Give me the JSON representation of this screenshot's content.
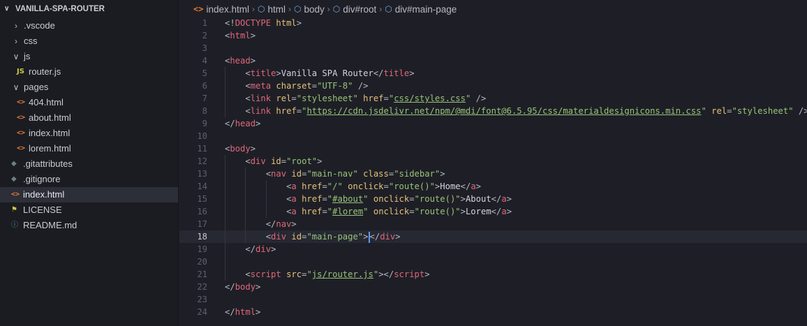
{
  "explorer": {
    "title": "VANILLA-SPA-ROUTER",
    "items": [
      {
        "label": ".vscode",
        "kind": "folder",
        "state": "collapsed",
        "depth": 1
      },
      {
        "label": "css",
        "kind": "folder",
        "state": "collapsed",
        "depth": 1
      },
      {
        "label": "js",
        "kind": "folder",
        "state": "expanded",
        "depth": 1
      },
      {
        "label": "router.js",
        "kind": "js",
        "depth": 2
      },
      {
        "label": "pages",
        "kind": "folder",
        "state": "expanded",
        "depth": 1
      },
      {
        "label": "404.html",
        "kind": "html",
        "depth": 2
      },
      {
        "label": "about.html",
        "kind": "html",
        "depth": 2
      },
      {
        "label": "index.html",
        "kind": "html",
        "depth": 2
      },
      {
        "label": "lorem.html",
        "kind": "html",
        "depth": 2
      },
      {
        "label": ".gitattributes",
        "kind": "git",
        "depth": 1
      },
      {
        "label": ".gitignore",
        "kind": "git",
        "depth": 1
      },
      {
        "label": "index.html",
        "kind": "html",
        "depth": 1,
        "selected": true
      },
      {
        "label": "LICENSE",
        "kind": "license",
        "depth": 1
      },
      {
        "label": "README.md",
        "kind": "info",
        "depth": 1
      }
    ]
  },
  "breadcrumb": [
    "index.html",
    "html",
    "body",
    "div#root",
    "div#main-page"
  ],
  "editor": {
    "current_line": 18,
    "lines": [
      [
        [
          "t-br",
          "<!"
        ],
        [
          "t-doctype",
          "DOCTYPE"
        ],
        [
          "t-text",
          " "
        ],
        [
          "t-attr",
          "html"
        ],
        [
          "t-br",
          ">"
        ]
      ],
      [
        [
          "t-br",
          "<"
        ],
        [
          "t-tag",
          "html"
        ],
        [
          "t-br",
          ">"
        ]
      ],
      [],
      [
        [
          "t-br",
          "<"
        ],
        [
          "t-tag",
          "head"
        ],
        [
          "t-br",
          ">"
        ]
      ],
      [
        [
          "t-text",
          "    "
        ],
        [
          "t-br",
          "<"
        ],
        [
          "t-tag",
          "title"
        ],
        [
          "t-br",
          ">"
        ],
        [
          "t-text",
          "Vanilla SPA Router"
        ],
        [
          "t-br",
          "</"
        ],
        [
          "t-tag",
          "title"
        ],
        [
          "t-br",
          ">"
        ]
      ],
      [
        [
          "t-text",
          "    "
        ],
        [
          "t-br",
          "<"
        ],
        [
          "t-tag",
          "meta"
        ],
        [
          "t-text",
          " "
        ],
        [
          "t-attr",
          "charset"
        ],
        [
          "t-br",
          "="
        ],
        [
          "t-str",
          "\"UTF-8\""
        ],
        [
          "t-text",
          " "
        ],
        [
          "t-br",
          "/>"
        ]
      ],
      [
        [
          "t-text",
          "    "
        ],
        [
          "t-br",
          "<"
        ],
        [
          "t-tag",
          "link"
        ],
        [
          "t-text",
          " "
        ],
        [
          "t-attr",
          "rel"
        ],
        [
          "t-br",
          "="
        ],
        [
          "t-str",
          "\"stylesheet\""
        ],
        [
          "t-text",
          " "
        ],
        [
          "t-attr",
          "href"
        ],
        [
          "t-br",
          "="
        ],
        [
          "t-str",
          "\""
        ],
        [
          "t-url",
          "css/styles.css"
        ],
        [
          "t-str",
          "\""
        ],
        [
          "t-text",
          " "
        ],
        [
          "t-br",
          "/>"
        ]
      ],
      [
        [
          "t-text",
          "    "
        ],
        [
          "t-br",
          "<"
        ],
        [
          "t-tag",
          "link"
        ],
        [
          "t-text",
          " "
        ],
        [
          "t-attr",
          "href"
        ],
        [
          "t-br",
          "="
        ],
        [
          "t-str",
          "\""
        ],
        [
          "t-url",
          "https://cdn.jsdelivr.net/npm/@mdi/font@6.5.95/css/materialdesignicons.min.css"
        ],
        [
          "t-str",
          "\""
        ],
        [
          "t-text",
          " "
        ],
        [
          "t-attr",
          "rel"
        ],
        [
          "t-br",
          "="
        ],
        [
          "t-str",
          "\"stylesheet\""
        ],
        [
          "t-text",
          " "
        ],
        [
          "t-br",
          "/>"
        ]
      ],
      [
        [
          "t-br",
          "</"
        ],
        [
          "t-tag",
          "head"
        ],
        [
          "t-br",
          ">"
        ]
      ],
      [],
      [
        [
          "t-br",
          "<"
        ],
        [
          "t-tag",
          "body"
        ],
        [
          "t-br",
          ">"
        ]
      ],
      [
        [
          "t-text",
          "    "
        ],
        [
          "t-br",
          "<"
        ],
        [
          "t-tag",
          "div"
        ],
        [
          "t-text",
          " "
        ],
        [
          "t-attr",
          "id"
        ],
        [
          "t-br",
          "="
        ],
        [
          "t-str",
          "\"root\""
        ],
        [
          "t-br",
          ">"
        ]
      ],
      [
        [
          "t-text",
          "        "
        ],
        [
          "t-br",
          "<"
        ],
        [
          "t-tag",
          "nav"
        ],
        [
          "t-text",
          " "
        ],
        [
          "t-attr",
          "id"
        ],
        [
          "t-br",
          "="
        ],
        [
          "t-str",
          "\"main-nav\""
        ],
        [
          "t-text",
          " "
        ],
        [
          "t-attr",
          "class"
        ],
        [
          "t-br",
          "="
        ],
        [
          "t-str",
          "\"sidebar\""
        ],
        [
          "t-br",
          ">"
        ]
      ],
      [
        [
          "t-text",
          "            "
        ],
        [
          "t-br",
          "<"
        ],
        [
          "t-tag",
          "a"
        ],
        [
          "t-text",
          " "
        ],
        [
          "t-attr",
          "href"
        ],
        [
          "t-br",
          "="
        ],
        [
          "t-str",
          "\"/\""
        ],
        [
          "t-text",
          " "
        ],
        [
          "t-attr",
          "onclick"
        ],
        [
          "t-br",
          "="
        ],
        [
          "t-str",
          "\"route()\""
        ],
        [
          "t-br",
          ">"
        ],
        [
          "t-text",
          "Home"
        ],
        [
          "t-br",
          "</"
        ],
        [
          "t-tag",
          "a"
        ],
        [
          "t-br",
          ">"
        ]
      ],
      [
        [
          "t-text",
          "            "
        ],
        [
          "t-br",
          "<"
        ],
        [
          "t-tag",
          "a"
        ],
        [
          "t-text",
          " "
        ],
        [
          "t-attr",
          "href"
        ],
        [
          "t-br",
          "="
        ],
        [
          "t-str",
          "\""
        ],
        [
          "t-url",
          "#about"
        ],
        [
          "t-str",
          "\""
        ],
        [
          "t-text",
          " "
        ],
        [
          "t-attr",
          "onclick"
        ],
        [
          "t-br",
          "="
        ],
        [
          "t-str",
          "\"route()\""
        ],
        [
          "t-br",
          ">"
        ],
        [
          "t-text",
          "About"
        ],
        [
          "t-br",
          "</"
        ],
        [
          "t-tag",
          "a"
        ],
        [
          "t-br",
          ">"
        ]
      ],
      [
        [
          "t-text",
          "            "
        ],
        [
          "t-br",
          "<"
        ],
        [
          "t-tag",
          "a"
        ],
        [
          "t-text",
          " "
        ],
        [
          "t-attr",
          "href"
        ],
        [
          "t-br",
          "="
        ],
        [
          "t-str",
          "\""
        ],
        [
          "t-url",
          "#lorem"
        ],
        [
          "t-str",
          "\""
        ],
        [
          "t-text",
          " "
        ],
        [
          "t-attr",
          "onclick"
        ],
        [
          "t-br",
          "="
        ],
        [
          "t-str",
          "\"route()\""
        ],
        [
          "t-br",
          ">"
        ],
        [
          "t-text",
          "Lorem"
        ],
        [
          "t-br",
          "</"
        ],
        [
          "t-tag",
          "a"
        ],
        [
          "t-br",
          ">"
        ]
      ],
      [
        [
          "t-text",
          "        "
        ],
        [
          "t-br",
          "</"
        ],
        [
          "t-tag",
          "nav"
        ],
        [
          "t-br",
          ">"
        ]
      ],
      [
        [
          "t-text",
          "        "
        ],
        [
          "t-br",
          "<"
        ],
        [
          "t-tag",
          "div"
        ],
        [
          "t-text",
          " "
        ],
        [
          "t-attr",
          "id"
        ],
        [
          "t-br",
          "="
        ],
        [
          "t-str",
          "\"main-page\""
        ],
        [
          "t-br",
          ">"
        ],
        [
          "cursor",
          ""
        ],
        [
          "t-br",
          "</"
        ],
        [
          "t-tag",
          "div"
        ],
        [
          "t-br",
          ">"
        ]
      ],
      [
        [
          "t-text",
          "    "
        ],
        [
          "t-br",
          "</"
        ],
        [
          "t-tag",
          "div"
        ],
        [
          "t-br",
          ">"
        ]
      ],
      [],
      [
        [
          "t-text",
          "    "
        ],
        [
          "t-br",
          "<"
        ],
        [
          "t-tag",
          "script"
        ],
        [
          "t-text",
          " "
        ],
        [
          "t-attr",
          "src"
        ],
        [
          "t-br",
          "="
        ],
        [
          "t-str",
          "\""
        ],
        [
          "t-url",
          "js/router.js"
        ],
        [
          "t-str",
          "\""
        ],
        [
          "t-br",
          "></"
        ],
        [
          "t-tag",
          "script"
        ],
        [
          "t-br",
          ">"
        ]
      ],
      [
        [
          "t-br",
          "</"
        ],
        [
          "t-tag",
          "body"
        ],
        [
          "t-br",
          ">"
        ]
      ],
      [],
      [
        [
          "t-br",
          "</"
        ],
        [
          "t-tag",
          "html"
        ],
        [
          "t-br",
          ">"
        ]
      ]
    ]
  }
}
